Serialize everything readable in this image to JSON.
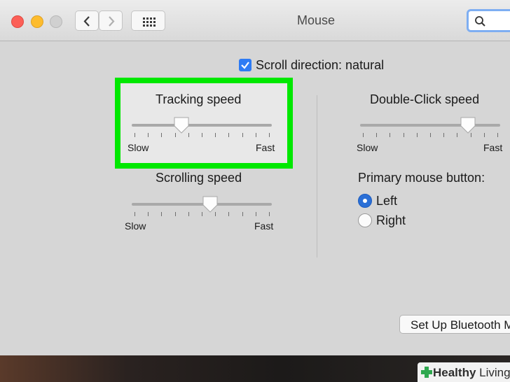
{
  "window": {
    "title": "Mouse"
  },
  "scroll_direction": {
    "label": "Scroll direction: natural",
    "checked": true
  },
  "tracking_speed": {
    "title": "Tracking speed",
    "min_label": "Slow",
    "max_label": "Fast",
    "value": 0.35
  },
  "scrolling_speed": {
    "title": "Scrolling speed",
    "min_label": "Slow",
    "max_label": "Fast",
    "value": 0.56
  },
  "double_click_speed": {
    "title": "Double-Click speed",
    "min_label": "Slow",
    "max_label": "Fast",
    "value": 0.78
  },
  "primary_button": {
    "title": "Primary mouse button:",
    "options": [
      "Left",
      "Right"
    ],
    "selected": "Left"
  },
  "bluetooth_button": {
    "label": "Set Up Bluetooth Mouse..."
  },
  "watermark": {
    "brand_bold": "Healthy",
    "brand_rest": " Living"
  },
  "colors": {
    "highlight": "#00e800",
    "accent": "#2d7bf4"
  }
}
